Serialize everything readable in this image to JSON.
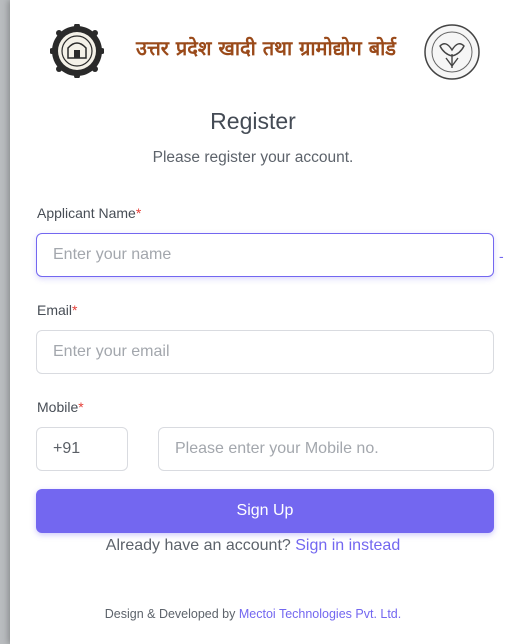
{
  "header": {
    "org_name": "उत्तर प्रदेश खादी तथा ग्रामोद्योग बोर्ड",
    "left_emblem": "khadi-board-emblem",
    "right_emblem": "up-state-emblem"
  },
  "form": {
    "title": "Register",
    "subtitle": "Please register your account.",
    "name": {
      "label": "Applicant Name",
      "required_mark": "*",
      "placeholder": "Enter your name",
      "value": ""
    },
    "email": {
      "label": "Email",
      "required_mark": "*",
      "placeholder": "Enter your email",
      "value": ""
    },
    "mobile": {
      "label": "Mobile",
      "required_mark": "*",
      "country_code": "+91",
      "placeholder": "Please enter your Mobile no.",
      "value": ""
    },
    "submit_label": "Sign Up",
    "signin_prompt": "Already have an account?",
    "signin_link": "Sign in instead"
  },
  "footer": {
    "text": "Design & Developed by",
    "company": "Mectoi Technologies Pvt. Ltd."
  },
  "colors": {
    "primary": "#7367f0",
    "required": "#e5403a",
    "org_text": "#9a4a1a"
  }
}
